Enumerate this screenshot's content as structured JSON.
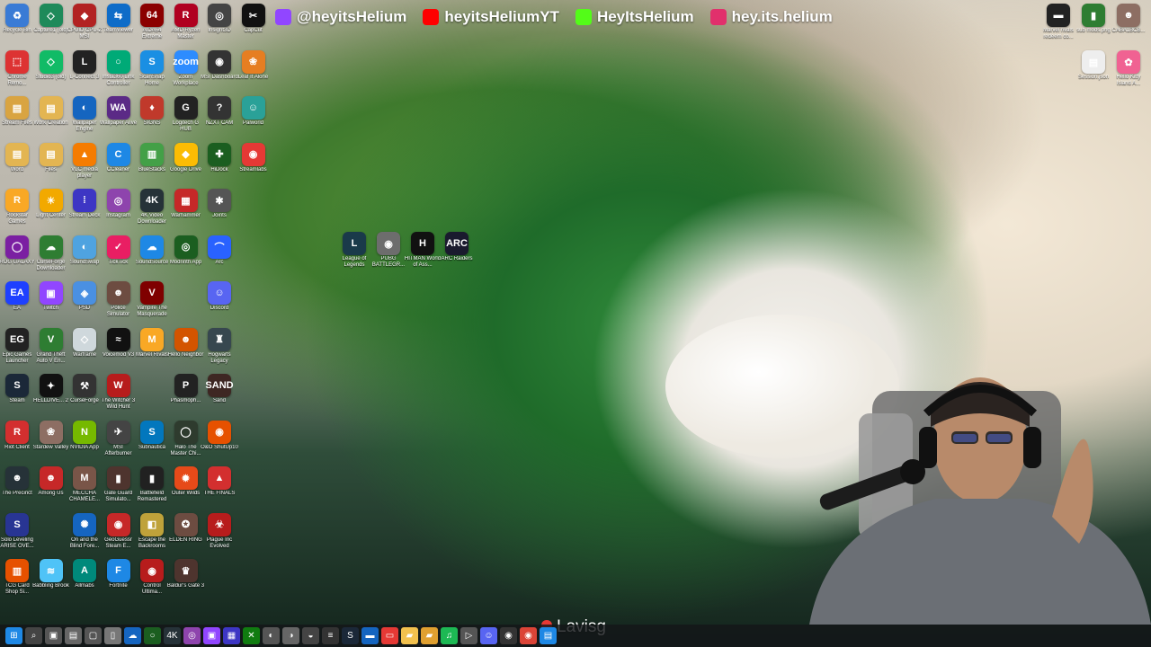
{
  "socials": [
    {
      "label": "@heyitsHelium",
      "platform": "twitch-icon",
      "color": "#9146ff"
    },
    {
      "label": "heyitsHeliumYT",
      "platform": "youtube-icon",
      "color": "#ff0000"
    },
    {
      "label": "HeyItsHelium",
      "platform": "kick-icon",
      "color": "#53fc18"
    },
    {
      "label": "hey.its.helium",
      "platform": "instagram-icon",
      "color": "#e1306c"
    }
  ],
  "desktop_icons": [
    {
      "label": "Recycle Bin",
      "glyph": "♻",
      "color": "#3a7bd5",
      "col": 0,
      "row": 0
    },
    {
      "label": "Capture1 (old)",
      "glyph": "◇",
      "color": "#1e8a5a",
      "col": 1,
      "row": 0
    },
    {
      "label": "CPUID CPU-Z MSI",
      "glyph": "◆",
      "color": "#b22222",
      "col": 2,
      "row": 0
    },
    {
      "label": "TeamViewer",
      "glyph": "⇆",
      "color": "#0e6cc8",
      "col": 3,
      "row": 0
    },
    {
      "label": "AIDA64 Extreme",
      "glyph": "64",
      "color": "#8b0000",
      "col": 4,
      "row": 0
    },
    {
      "label": "AMD Ryzen Master",
      "glyph": "R",
      "color": "#b00020",
      "col": 5,
      "row": 0
    },
    {
      "label": "Insight3D",
      "glyph": "◎",
      "color": "#444",
      "col": 6,
      "row": 0
    },
    {
      "label": "CapCut",
      "glyph": "✂",
      "color": "#111",
      "col": 7,
      "row": 0
    },
    {
      "label": "Chrome Remo...",
      "glyph": "⬚",
      "color": "#d33",
      "col": 0,
      "row": 1
    },
    {
      "label": "Studio3 (old)",
      "glyph": "◇",
      "color": "#1b6",
      "col": 1,
      "row": 1
    },
    {
      "label": "L-Connect 3",
      "glyph": "L",
      "color": "#222",
      "col": 2,
      "row": 1
    },
    {
      "label": "Insta360 Link Controller",
      "glyph": "○",
      "color": "#0a7",
      "col": 3,
      "row": 1
    },
    {
      "label": "ScanSnap Home",
      "glyph": "S",
      "color": "#1a8fe3",
      "col": 4,
      "row": 1
    },
    {
      "label": "Zoom Workplace",
      "glyph": "zoom",
      "color": "#2d8cff",
      "col": 5,
      "row": 1
    },
    {
      "label": "MSI Dashboard",
      "glyph": "◉",
      "color": "#333",
      "col": 6,
      "row": 1
    },
    {
      "label": "Leaf It Alone",
      "glyph": "❀",
      "color": "#e67e22",
      "col": 7,
      "row": 1
    },
    {
      "label": "Stream Files",
      "glyph": "▤",
      "color": "#d9a441",
      "col": 0,
      "row": 2
    },
    {
      "label": "Work Creation",
      "glyph": "▤",
      "color": "#e3b552",
      "col": 1,
      "row": 2
    },
    {
      "label": "Wallpaper Engine",
      "glyph": "◐",
      "color": "#1565c0",
      "col": 2,
      "row": 2
    },
    {
      "label": "Wallpaper Alive",
      "glyph": "WA",
      "color": "#5b2a86",
      "col": 3,
      "row": 2
    },
    {
      "label": "SIGNS",
      "glyph": "♦",
      "color": "#c0392b",
      "col": 4,
      "row": 2
    },
    {
      "label": "Logitech G HUB",
      "glyph": "G",
      "color": "#222",
      "col": 5,
      "row": 2
    },
    {
      "label": "NZXT CAM",
      "glyph": "?",
      "color": "#333",
      "col": 6,
      "row": 2
    },
    {
      "label": "Palworld",
      "glyph": "☺",
      "color": "#2aa198",
      "col": 7,
      "row": 2
    },
    {
      "label": "Word",
      "glyph": "▤",
      "color": "#e3b552",
      "col": 0,
      "row": 3
    },
    {
      "label": "Files",
      "glyph": "▤",
      "color": "#e3b552",
      "col": 1,
      "row": 3
    },
    {
      "label": "VLC media player",
      "glyph": "▲",
      "color": "#f57c00",
      "col": 2,
      "row": 3
    },
    {
      "label": "CCleaner",
      "glyph": "C",
      "color": "#1e88e5",
      "col": 3,
      "row": 3
    },
    {
      "label": "BlueStacks",
      "glyph": "▥",
      "color": "#43a047",
      "col": 4,
      "row": 3
    },
    {
      "label": "Google Drive",
      "glyph": "◆",
      "color": "#fbbc04",
      "col": 5,
      "row": 3
    },
    {
      "label": "HiDock",
      "glyph": "✚",
      "color": "#1b5e20",
      "col": 6,
      "row": 3
    },
    {
      "label": "Streamlabs",
      "glyph": "◉",
      "color": "#e53935",
      "col": 7,
      "row": 3
    },
    {
      "label": "Rockstar Games",
      "glyph": "R",
      "color": "#f9a825",
      "col": 0,
      "row": 4
    },
    {
      "label": "Light Center",
      "glyph": "☀",
      "color": "#f2a900",
      "col": 1,
      "row": 4
    },
    {
      "label": "Stream Deck",
      "glyph": "⁞",
      "color": "#3d36c4",
      "col": 2,
      "row": 4
    },
    {
      "label": "Instagram",
      "glyph": "◎",
      "color": "#8e44ad",
      "col": 3,
      "row": 4
    },
    {
      "label": "4K Video Downloader",
      "glyph": "4K",
      "color": "#263238",
      "col": 4,
      "row": 4
    },
    {
      "label": "Warhammer",
      "glyph": "▦",
      "color": "#c62828",
      "col": 5,
      "row": 4
    },
    {
      "label": "Joints",
      "glyph": "✱",
      "color": "#555",
      "col": 6,
      "row": 4
    },
    {
      "label": "ROG GALAXY",
      "glyph": "◯",
      "color": "#7b1fa2",
      "col": 0,
      "row": 5
    },
    {
      "label": "CurseForge Downloader",
      "glyph": "☁",
      "color": "#2e7d32",
      "col": 1,
      "row": 5
    },
    {
      "label": "SoundSwap",
      "glyph": "◐",
      "color": "#4fa3e0",
      "col": 2,
      "row": 5
    },
    {
      "label": "TickTick",
      "glyph": "✓",
      "color": "#e91e63",
      "col": 3,
      "row": 5
    },
    {
      "label": "SoundSource",
      "glyph": "☁",
      "color": "#1e88e5",
      "col": 4,
      "row": 5
    },
    {
      "label": "Modrinth App",
      "glyph": "◎",
      "color": "#1b5e20",
      "col": 5,
      "row": 5
    },
    {
      "label": "Arc",
      "glyph": "⌒",
      "color": "#2962ff",
      "col": 6,
      "row": 5
    },
    {
      "label": "EA",
      "glyph": "EA",
      "color": "#1e40ff",
      "col": 0,
      "row": 6
    },
    {
      "label": "Twitch",
      "glyph": "▣",
      "color": "#9146ff",
      "col": 1,
      "row": 6
    },
    {
      "label": "PSD",
      "glyph": "◈",
      "color": "#4a90e2",
      "col": 2,
      "row": 6
    },
    {
      "label": "Police Simulator",
      "glyph": "☻",
      "color": "#6d4c41",
      "col": 3,
      "row": 6
    },
    {
      "label": "Vampire The Masquerade",
      "glyph": "V",
      "color": "#7f0000",
      "col": 4,
      "row": 6
    },
    {
      "label": "Discord",
      "glyph": "☺",
      "color": "#5865f2",
      "col": 6,
      "row": 6
    },
    {
      "label": "Epic Games Launcher",
      "glyph": "EG",
      "color": "#222",
      "col": 0,
      "row": 7
    },
    {
      "label": "Grand Theft Auto V En...",
      "glyph": "V",
      "color": "#2e7d32",
      "col": 1,
      "row": 7
    },
    {
      "label": "Warframe",
      "glyph": "◇",
      "color": "#cfd8dc",
      "col": 2,
      "row": 7
    },
    {
      "label": "Voicemod V3",
      "glyph": "≈",
      "color": "#111",
      "col": 3,
      "row": 7
    },
    {
      "label": "Marvel Rivals",
      "glyph": "M",
      "color": "#f9a825",
      "col": 4,
      "row": 7
    },
    {
      "label": "Hello Neighbor",
      "glyph": "☻",
      "color": "#d35400",
      "col": 5,
      "row": 7
    },
    {
      "label": "Hogwarts Legacy",
      "glyph": "♜",
      "color": "#37474f",
      "col": 6,
      "row": 7
    },
    {
      "label": "Steam",
      "glyph": "S",
      "color": "#1b2838",
      "col": 0,
      "row": 8
    },
    {
      "label": "HELLDIVE... 2",
      "glyph": "✦",
      "color": "#111",
      "col": 1,
      "row": 8
    },
    {
      "label": "CurseForge",
      "glyph": "⚒",
      "color": "#333",
      "col": 2,
      "row": 8
    },
    {
      "label": "The Witcher 3 Wild Hunt",
      "glyph": "W",
      "color": "#b71c1c",
      "col": 3,
      "row": 8
    },
    {
      "label": "Phasmoph...",
      "glyph": "P",
      "color": "#222",
      "col": 5,
      "row": 8
    },
    {
      "label": "Sand",
      "glyph": "SAND",
      "color": "#3e2723",
      "col": 6,
      "row": 8
    },
    {
      "label": "Riot Client",
      "glyph": "R",
      "color": "#d32f2f",
      "col": 0,
      "row": 9
    },
    {
      "label": "Stardew Valley",
      "glyph": "❀",
      "color": "#8d6e63",
      "col": 1,
      "row": 9
    },
    {
      "label": "NVIDIA App",
      "glyph": "N",
      "color": "#76b900",
      "col": 2,
      "row": 9
    },
    {
      "label": "MSI Afterburner",
      "glyph": "✈",
      "color": "#444",
      "col": 3,
      "row": 9
    },
    {
      "label": "Subnautica",
      "glyph": "S",
      "color": "#0277bd",
      "col": 4,
      "row": 9
    },
    {
      "label": "Halo The Master Chi...",
      "glyph": "◯",
      "color": "#2e3b2e",
      "col": 5,
      "row": 9
    },
    {
      "label": "O&O ShutUp10",
      "glyph": "◉",
      "color": "#e65100",
      "col": 6,
      "row": 9
    },
    {
      "label": "The Precinct",
      "glyph": "☻",
      "color": "#263238",
      "col": 0,
      "row": 10
    },
    {
      "label": "Among Us",
      "glyph": "☻",
      "color": "#c62828",
      "col": 1,
      "row": 10
    },
    {
      "label": "MECCHA CHAMELE...",
      "glyph": "M",
      "color": "#795548",
      "col": 2,
      "row": 10
    },
    {
      "label": "Gate Guard Simulato...",
      "glyph": "▮",
      "color": "#4e342e",
      "col": 3,
      "row": 10
    },
    {
      "label": "Battlefield Remastered",
      "glyph": "▮",
      "color": "#212121",
      "col": 4,
      "row": 10
    },
    {
      "label": "Outer Wilds",
      "glyph": "✹",
      "color": "#e64a19",
      "col": 5,
      "row": 10
    },
    {
      "label": "THE FINALS",
      "glyph": "▲",
      "color": "#d32f2f",
      "col": 6,
      "row": 10
    },
    {
      "label": "Solo Leveling ARISE OVE...",
      "glyph": "S",
      "color": "#283593",
      "col": 0,
      "row": 11
    },
    {
      "label": "Ori and the Blind Fore...",
      "glyph": "✺",
      "color": "#1565c0",
      "col": 2,
      "row": 11
    },
    {
      "label": "GeoGuessr Steam E...",
      "glyph": "◉",
      "color": "#c62828",
      "col": 3,
      "row": 11
    },
    {
      "label": "Escape the Backrooms",
      "glyph": "◧",
      "color": "#bfa23a",
      "col": 4,
      "row": 11
    },
    {
      "label": "ELDEN RING",
      "glyph": "✪",
      "color": "#6d4c41",
      "col": 5,
      "row": 11
    },
    {
      "label": "Plague Inc Evolved",
      "glyph": "☣",
      "color": "#b71c1c",
      "col": 6,
      "row": 11
    },
    {
      "label": "TCG Card Shop Si...",
      "glyph": "▥",
      "color": "#e65100",
      "col": 0,
      "row": 12
    },
    {
      "label": "Babbling Brook",
      "glyph": "≋",
      "color": "#4fc3f7",
      "col": 1,
      "row": 12
    },
    {
      "label": "Allmabs",
      "glyph": "A",
      "color": "#00897b",
      "col": 2,
      "row": 12
    },
    {
      "label": "Fortnite",
      "glyph": "F",
      "color": "#1e88e5",
      "col": 3,
      "row": 12
    },
    {
      "label": "Control Ultima...",
      "glyph": "◉",
      "color": "#b71c1c",
      "col": 4,
      "row": 12
    },
    {
      "label": "Baldur's Gate 3",
      "glyph": "♛",
      "color": "#4e342e",
      "col": 5,
      "row": 12
    }
  ],
  "right_icons": [
    {
      "label": "Marvel rivals redeem co...",
      "glyph": "▬",
      "color": "#222"
    },
    {
      "label": "sub mods.png",
      "glyph": "▮",
      "color": "#2e7d32"
    },
    {
      "label": "CABA1BCB...",
      "glyph": "☻",
      "color": "#8d6e63"
    },
    {
      "label": "Session.json",
      "glyph": "▤",
      "color": "#eeeeee"
    },
    {
      "label": "Hello Kitty Island A...",
      "glyph": "✿",
      "color": "#f06292"
    }
  ],
  "game_icons": [
    {
      "label": "League of Legends",
      "glyph": "L",
      "color": "#1a3a4a"
    },
    {
      "label": "PUBG BATTLEGR...",
      "glyph": "◉",
      "color": "#6d6d6d"
    },
    {
      "label": "HITMAN World of Ass...",
      "glyph": "H",
      "color": "#111"
    },
    {
      "label": "ARC Raiders",
      "glyph": "ARC",
      "color": "#1a1a2e"
    }
  ],
  "taskbar": [
    {
      "name": "windows-start-icon",
      "glyph": "⊞",
      "color": "#1e88e5"
    },
    {
      "name": "search-icon",
      "glyph": "⌕",
      "color": "#444"
    },
    {
      "name": "task-view-icon",
      "glyph": "▣",
      "color": "#555"
    },
    {
      "name": "notepad-icon",
      "glyph": "▤",
      "color": "#666"
    },
    {
      "name": "app-icon",
      "glyph": "▢",
      "color": "#555"
    },
    {
      "name": "document-icon",
      "glyph": "▯",
      "color": "#777"
    },
    {
      "name": "app-icon",
      "glyph": "☁",
      "color": "#1565c0"
    },
    {
      "name": "app-icon",
      "glyph": "○",
      "color": "#1b5e20"
    },
    {
      "name": "4k-icon",
      "glyph": "4K",
      "color": "#263238"
    },
    {
      "name": "app-icon",
      "glyph": "◎",
      "color": "#8e44ad"
    },
    {
      "name": "twitch-icon",
      "glyph": "▣",
      "color": "#9146ff"
    },
    {
      "name": "app-icon",
      "glyph": "▦",
      "color": "#3d36c4"
    },
    {
      "name": "xbox-icon",
      "glyph": "✕",
      "color": "#107c10"
    },
    {
      "name": "app-icon",
      "glyph": "◐",
      "color": "#555"
    },
    {
      "name": "app-icon",
      "glyph": "◑",
      "color": "#666"
    },
    {
      "name": "app-icon",
      "glyph": "◒",
      "color": "#444"
    },
    {
      "name": "app-icon",
      "glyph": "≡",
      "color": "#333"
    },
    {
      "name": "steam-icon",
      "glyph": "S",
      "color": "#1b2838"
    },
    {
      "name": "app-icon",
      "glyph": "▬",
      "color": "#1565c0"
    },
    {
      "name": "app-icon",
      "glyph": "▭",
      "color": "#e53935"
    },
    {
      "name": "folder-icon",
      "glyph": "▰",
      "color": "#f2c14e"
    },
    {
      "name": "explorer-icon",
      "glyph": "▰",
      "color": "#e0a030"
    },
    {
      "name": "spotify-icon",
      "glyph": "♫",
      "color": "#1db954"
    },
    {
      "name": "app-icon",
      "glyph": "▷",
      "color": "#555"
    },
    {
      "name": "discord-icon",
      "glyph": "☺",
      "color": "#5865f2"
    },
    {
      "name": "app-icon",
      "glyph": "◉",
      "color": "#333"
    },
    {
      "name": "chrome-icon",
      "glyph": "◉",
      "color": "#db4437"
    },
    {
      "name": "app-icon",
      "glyph": "▤",
      "color": "#1e88e5"
    }
  ],
  "overlay": {
    "name": "Lavisg",
    "pin_color": "#e53935"
  }
}
